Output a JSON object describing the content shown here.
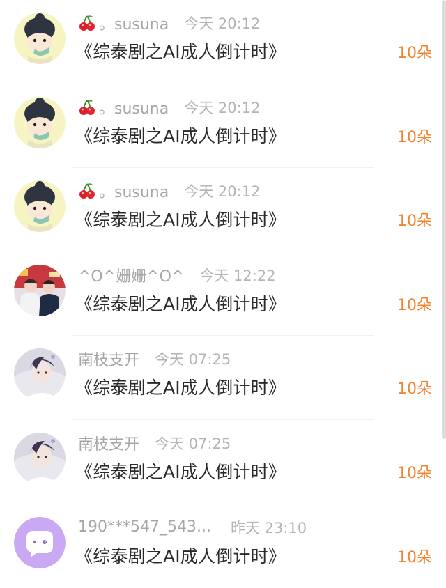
{
  "gifts": [
    {
      "user": "。susuna",
      "time": "今天 20:12",
      "title": "《综泰剧之AI成人倒计时》",
      "count": "10朵",
      "avatar": "cartoon-boy-avatar",
      "cherry": true
    },
    {
      "user": "。susuna",
      "time": "今天 20:12",
      "title": "《综泰剧之AI成人倒计时》",
      "count": "10朵",
      "avatar": "cartoon-boy-avatar",
      "cherry": true
    },
    {
      "user": "。susuna",
      "time": "今天 20:12",
      "title": "《综泰剧之AI成人倒计时》",
      "count": "10朵",
      "avatar": "cartoon-boy-avatar",
      "cherry": true
    },
    {
      "user": "^O^姗姗^O^",
      "time": "今天 12:22",
      "title": "《综泰剧之AI成人倒计时》",
      "count": "10朵",
      "avatar": "photo-avatar",
      "cherry": false
    },
    {
      "user": "南枝支开",
      "time": "今天 07:25",
      "title": "《综泰剧之AI成人倒计时》",
      "count": "10朵",
      "avatar": "photo-avatar",
      "cherry": false
    },
    {
      "user": "南枝支开",
      "time": "今天 07:25",
      "title": "《综泰剧之AI成人倒计时》",
      "count": "10朵",
      "avatar": "photo-avatar",
      "cherry": false
    },
    {
      "user": "190***547_543...",
      "time": "昨天 23:10",
      "title": "《综泰剧之AI成人倒计时》",
      "count": "10朵",
      "avatar": "default-chat-avatar",
      "cherry": false
    }
  ],
  "colors": {
    "accent": "#f1832f",
    "muted": "#a6a6a6",
    "text": "#2b2b2b"
  }
}
